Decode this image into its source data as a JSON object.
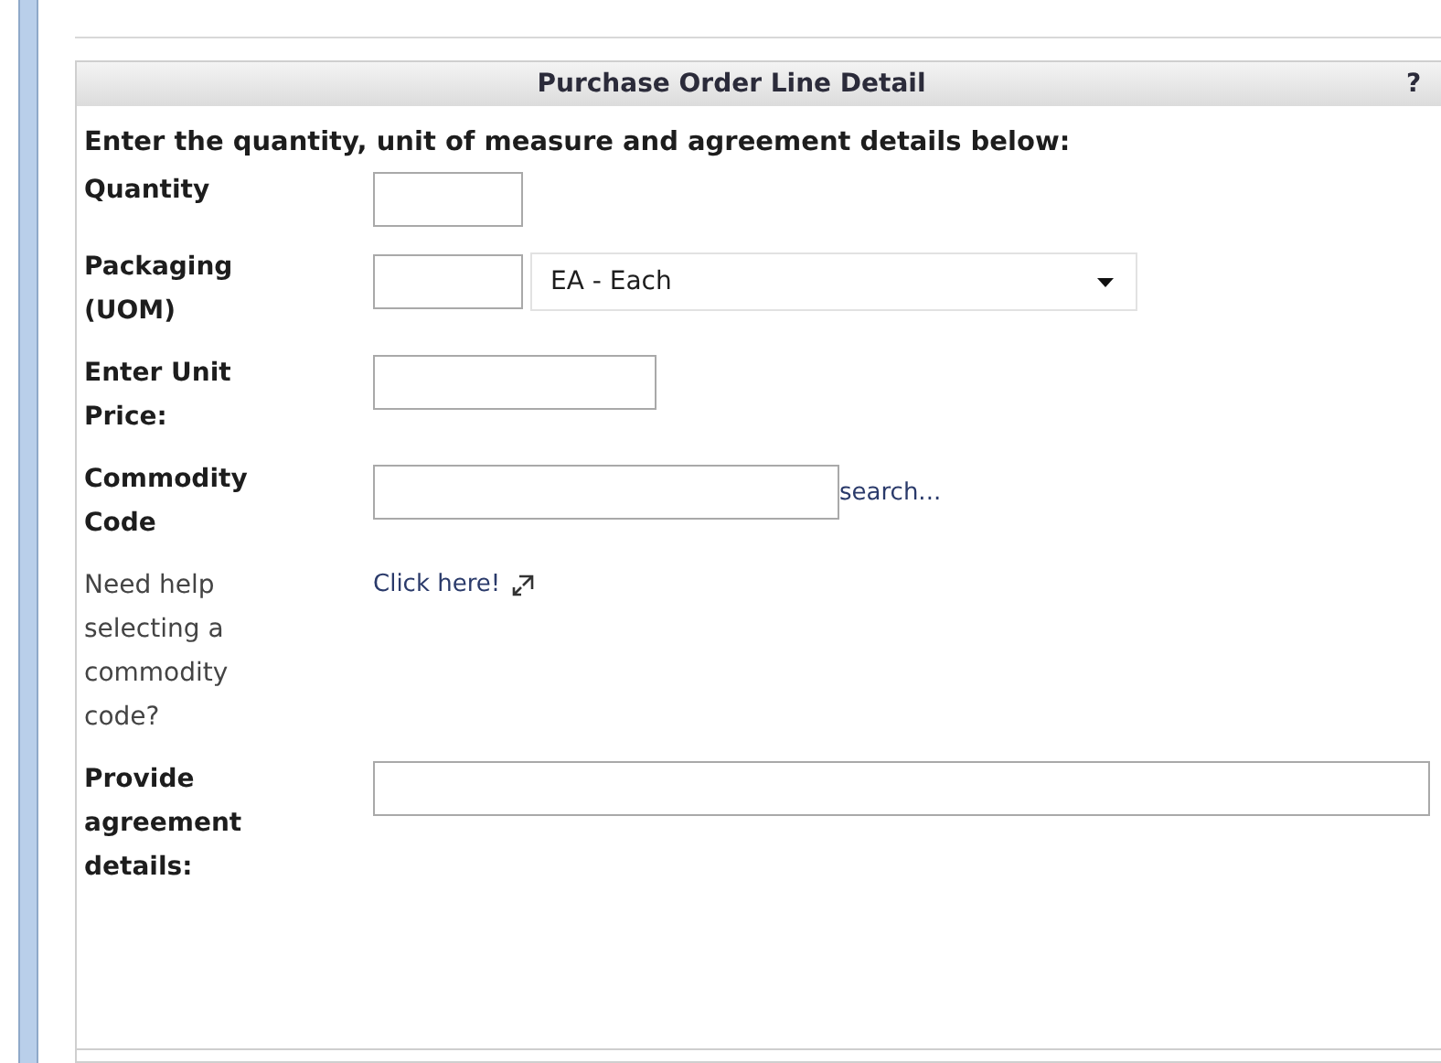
{
  "panel": {
    "title": "Purchase Order Line Detail",
    "help": "?"
  },
  "instruction": "Enter the quantity, unit of measure and agreement details below:",
  "rows": [
    {
      "kind": "short",
      "label": "Quantity"
    },
    {
      "kind": "uom",
      "label": "Packaging (UOM)",
      "select": "EA - Each"
    },
    {
      "kind": "medium",
      "label": "Enter Unit Price:"
    },
    {
      "kind": "lookup",
      "label": "Commodity Code",
      "link": "search..."
    },
    {
      "kind": "help",
      "label": "Need help selecting a commodity code?",
      "link": "Click here!"
    },
    {
      "kind": "wide",
      "label": "Provide agreement details:"
    }
  ]
}
